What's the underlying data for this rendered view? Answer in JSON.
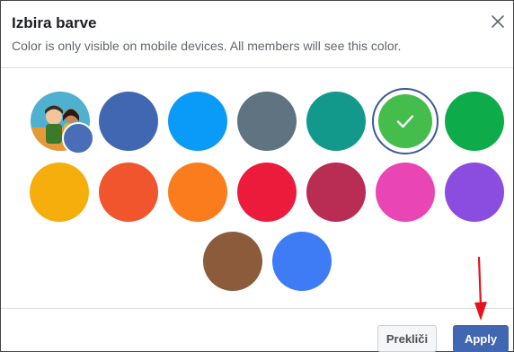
{
  "dialog": {
    "title": "Izbira barve",
    "subtitle": "Color is only visible on mobile devices. All members will see this color.",
    "close_icon": "close-icon"
  },
  "swatches": {
    "avatar": {
      "name": "group-avatar",
      "dot_color": "#4a6db7"
    },
    "colors": [
      {
        "name": "dark-blue",
        "color": "#4267b2",
        "selected": false
      },
      {
        "name": "sky-blue",
        "color": "#0a9af7",
        "selected": false
      },
      {
        "name": "slate-gray",
        "color": "#5f7380",
        "selected": false
      },
      {
        "name": "teal",
        "color": "#13998b",
        "selected": false
      },
      {
        "name": "light-green",
        "color": "#44bd4c",
        "selected": true
      },
      {
        "name": "green",
        "color": "#0dab4a",
        "selected": false
      },
      {
        "name": "amber",
        "color": "#f6ae0c",
        "selected": false
      },
      {
        "name": "red-orange",
        "color": "#f1552d",
        "selected": false
      },
      {
        "name": "orange",
        "color": "#fb7c1c",
        "selected": false
      },
      {
        "name": "crimson",
        "color": "#ec1b3c",
        "selected": false
      },
      {
        "name": "raspberry",
        "color": "#b92c54",
        "selected": false
      },
      {
        "name": "magenta",
        "color": "#e945b5",
        "selected": false
      },
      {
        "name": "purple",
        "color": "#8a4de0",
        "selected": false
      },
      {
        "name": "brown",
        "color": "#8c5b3c",
        "selected": false
      },
      {
        "name": "cornflower-blue",
        "color": "#3e7cf6",
        "selected": false
      }
    ]
  },
  "footer": {
    "cancel_label": "Prekliči",
    "apply_label": "Apply"
  },
  "annotation": {
    "arrow_color": "#e5131b"
  }
}
